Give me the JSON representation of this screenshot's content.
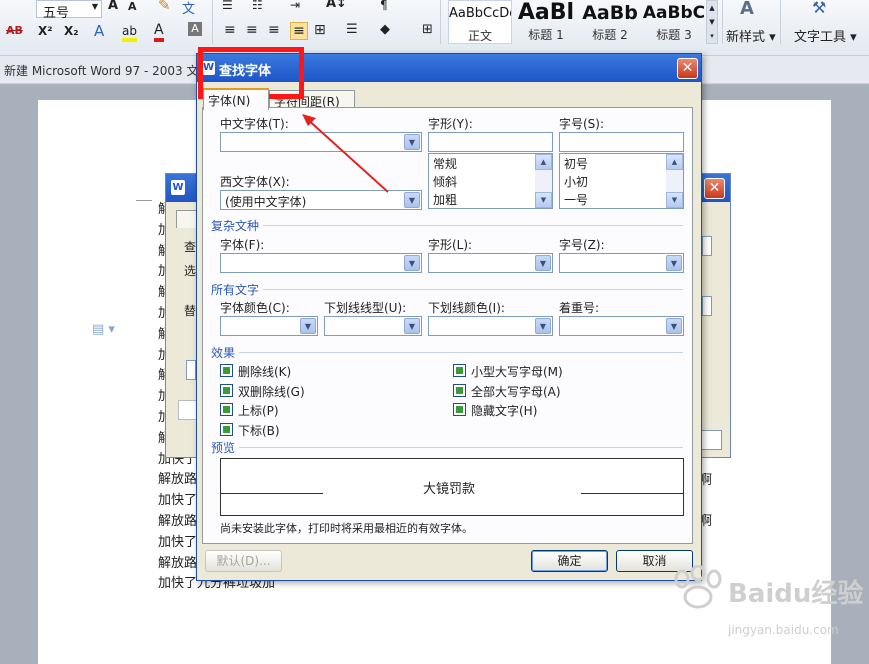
{
  "ribbon": {
    "font_size": "五号",
    "styles": [
      {
        "preview": "AaBbCcDd",
        "name": "正文"
      },
      {
        "preview": "AaBl",
        "name": "标题 1"
      },
      {
        "preview": "AaBb",
        "name": "标题 2"
      },
      {
        "preview": "AaBbC",
        "name": "标题 3"
      }
    ],
    "new_style": "新样式",
    "text_tools": "文字工具",
    "row1_glyphs": [
      "A",
      "A",
      "A"
    ],
    "row2_glyphs": [
      "AB",
      "X²",
      "X₂",
      "A",
      "ab",
      "A",
      "A"
    ]
  },
  "window": {
    "title": "新建 Microsoft Word 97 - 2003 文"
  },
  "document": {
    "lines": [
      "解",
      "加",
      "解",
      "加",
      "解",
      "加",
      "解",
      "加",
      "解",
      "加",
      "加",
      "解放",
      "加快了",
      "解放路",
      "加快了",
      "解放路",
      "加快了",
      "解放路卡积分全面喇叭大镜罚款积分卡积分卡中方可令肮脏下移 法打动卡仗计费可垃圾啊",
      "加快了九分裤垃圾加"
    ],
    "line_right_fragments": [
      "啊",
      "啊"
    ]
  },
  "bg_dialog": {
    "labels": [
      "查",
      "选",
      "替"
    ]
  },
  "dialog": {
    "title": "查找字体",
    "tabs": [
      "字体(N)",
      "字符间距(R)"
    ],
    "chinese_font_label": "中文字体(T):",
    "chinese_font_value": "",
    "style_label": "字形(Y):",
    "size_label": "字号(S):",
    "style_items": [
      "常规",
      "倾斜",
      "加粗"
    ],
    "size_items": [
      "初号",
      "小初",
      "一号"
    ],
    "western_font_label": "西文字体(X):",
    "western_font_value": "(使用中文字体)",
    "complex_section": "复杂文种",
    "complex_font_label": "字体(F):",
    "complex_style_label": "字形(L):",
    "complex_size_label": "字号(Z):",
    "all_text_section": "所有文字",
    "font_color_label": "字体颜色(C):",
    "underline_type_label": "下划线线型(U):",
    "underline_color_label": "下划线颜色(I):",
    "emphasis_label": "着重号:",
    "effects_section": "效果",
    "effects_left": [
      "删除线(K)",
      "双删除线(G)",
      "上标(P)",
      "下标(B)"
    ],
    "effects_right": [
      "小型大写字母(M)",
      "全部大写字母(A)",
      "隐藏文字(H)"
    ],
    "preview_section": "预览",
    "preview_text": "大镜罚款",
    "note": "尚未安装此字体，打印时将采用最相近的有效字体。",
    "default_button": "默认(D)...",
    "ok_button": "确定",
    "cancel_button": "取消"
  },
  "watermark": {
    "brand": "Baidu经验",
    "url": "jingyan.baidu.com"
  },
  "colors": {
    "highlight_box": "#ff1616",
    "arrow": "#e8201d",
    "titlebar": "#1d55c8"
  }
}
